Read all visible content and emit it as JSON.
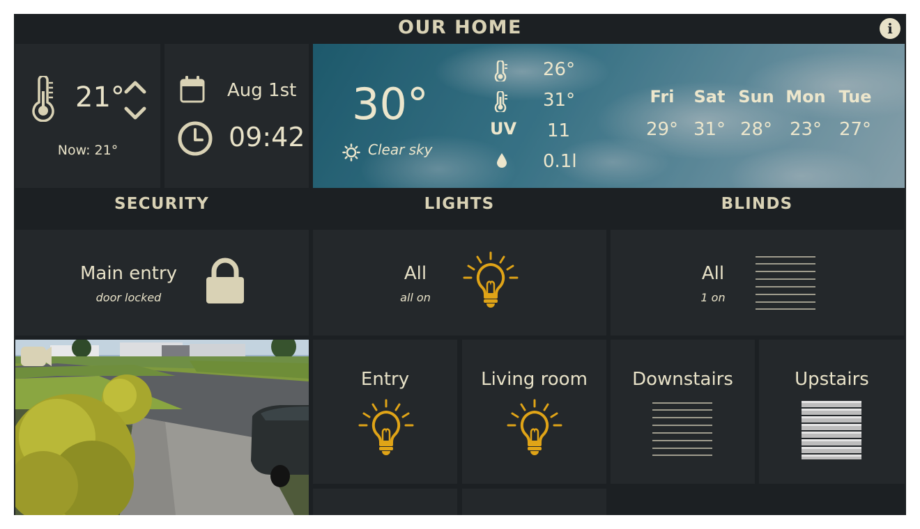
{
  "header": {
    "title": "OUR HOME",
    "info_label": "i"
  },
  "thermostat": {
    "setpoint": "21°",
    "now": "Now: 21°"
  },
  "datetime": {
    "date": "Aug 1st",
    "time": "09:42"
  },
  "weather": {
    "temp": "30°",
    "condition": "Clear sky",
    "details": {
      "temp_low": "26°",
      "temp_high": "31°",
      "uv_label": "UV",
      "uv": "11",
      "rain": "0.1l"
    },
    "forecast": [
      {
        "day": "Fri",
        "temp": "29°"
      },
      {
        "day": "Sat",
        "temp": "31°"
      },
      {
        "day": "Sun",
        "temp": "28°"
      },
      {
        "day": "Mon",
        "temp": "23°"
      },
      {
        "day": "Tue",
        "temp": "27°"
      }
    ]
  },
  "sections": {
    "security": "SECURITY",
    "lights": "LIGHTS",
    "blinds": "BLINDS"
  },
  "security": {
    "label": "Main entry",
    "status": "door locked"
  },
  "lights": {
    "all": {
      "label": "All",
      "status": "all on"
    },
    "rooms": [
      {
        "label": "Entry"
      },
      {
        "label": "Living room"
      }
    ]
  },
  "blinds": {
    "all": {
      "label": "All",
      "status": "1 on"
    },
    "rooms": [
      {
        "label": "Downstairs"
      },
      {
        "label": "Upstairs"
      }
    ]
  },
  "colors": {
    "accent_bulb": "#e0a417",
    "panel": "#24282b",
    "background": "#1c2023",
    "text": "#d9d2b5"
  }
}
